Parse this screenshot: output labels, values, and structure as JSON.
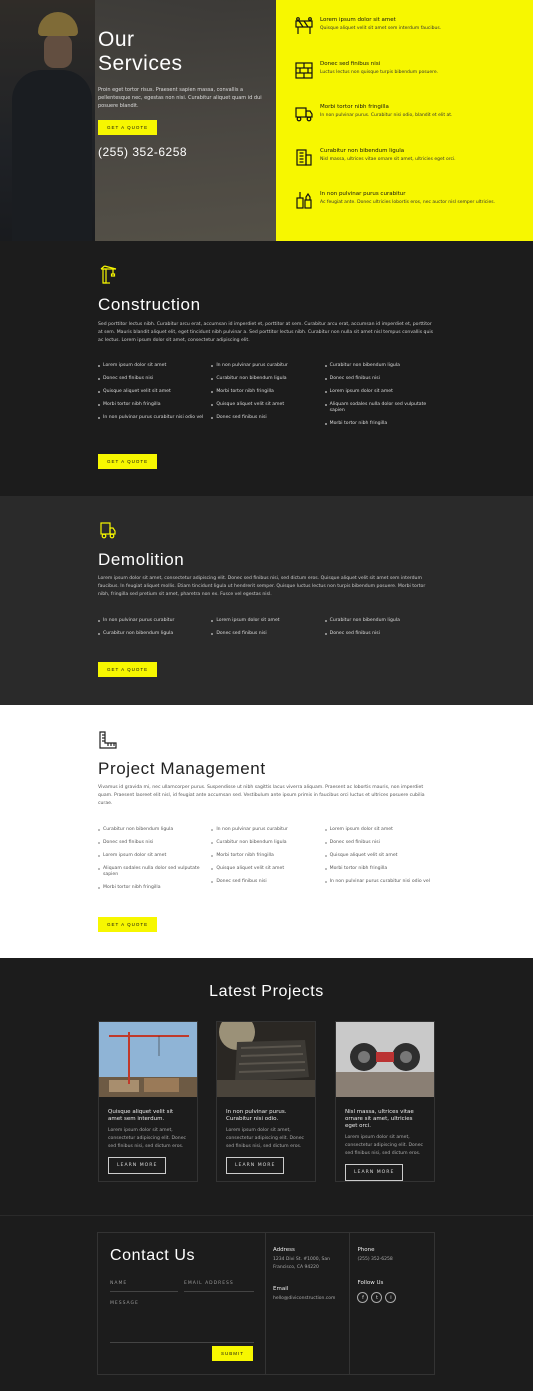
{
  "hero": {
    "title_line1": "Our",
    "title_line2": "Services",
    "description": "Proin eget tortor risus. Praesent sapien massa, convallis a pellentesque nec, egestas non nisi. Curabitur aliquet quam id dui posuere blandit.",
    "cta": "GET A QUOTE",
    "phone": "(255) 352-6258"
  },
  "services": [
    {
      "icon": "road-barrier-icon",
      "title": "Lorem ipsum dolor sit amet",
      "desc": "Quisque aliquet velit sit amet sem interdum faucibus."
    },
    {
      "icon": "brick-wall-icon",
      "title": "Donec sed finibus nisi",
      "desc": "Luctus lectus non quisque turpis bibendum posuere."
    },
    {
      "icon": "truck-icon",
      "title": "Morbi tortor nibh fringilla",
      "desc": "In non pulvinar purus. Curabitur nisi odio, blandit et elit at."
    },
    {
      "icon": "building-icon",
      "title": "Curabitur non bibendum ligula",
      "desc": "Nisl massa, ultrices vitae ornare sit amet, ultricies eget orci."
    },
    {
      "icon": "paint-tools-icon",
      "title": "In non pulvinar purus curabitur",
      "desc": "Ac feugiat ante. Donec ultricies lobortis eros, nec auctor nisl semper ultricies."
    }
  ],
  "construction": {
    "title": "Construction",
    "description": "Sed porttitor lectus nibh. Curabitur arcu erat, accumsan id imperdiet et, porttitor at sem. Curabitur arcu erat, accumsan id imperdiet et, porttitor at sem. Mauris blandit aliquet elit, eget tincidunt nibh pulvinar a. Sed porttitor lectus nibh. Curabitur non nulla sit amet nisl tempus convallis quis ac lectus. Lorem ipsum dolor sit amet, consectetur adipiscing elit.",
    "col1": [
      "Lorem ipsum dolor sit amet",
      "Donec sed finibus nisi",
      "Quisque aliquet velit sit amet",
      "Morbi tortor nibh fringilla",
      "In non pulvinar purus curabitur nisi odio vel"
    ],
    "col2": [
      "In non pulvinar purus curabitur",
      "Curabitur non bibendum ligula",
      "Morbi tortor nibh fringilla",
      "Quisque aliquet velit sit amet",
      "Donec sed finibus nisi"
    ],
    "col3": [
      "Curabitur non bibendum ligula",
      "Donec sed finibus nisi",
      "Lorem ipsum dolor sit amet",
      "Aliquam sodales nulla dolor sed vulputate sapien",
      "Morbi tortor nibh fringilla"
    ],
    "cta": "GET A QUOTE"
  },
  "demolition": {
    "title": "Demolition",
    "description": "Lorem ipsum dolor sit amet, consectetur adipiscing elit. Donec sed finibus nisi, sed dictum eros. Quisque aliquet velit sit amet sem interdum faucibus. In feugiat aliquet mollis. Etiam tincidunt ligula ut hendrerit semper. Quisque luctus lectus non turpis bibendum posuere. Morbi tortor nibh, fringilla sed pretium sit amet, pharetra non ex. Fusce vel egestas nisl.",
    "col1": [
      "In non pulvinar purus curabitur",
      "Curabitur non bibendum ligula"
    ],
    "col2": [
      "Lorem ipsum dolor sit amet",
      "Donec sed finibus nisi"
    ],
    "col3": [
      "Curabitur non bibendum ligula",
      "Donec sed finibus nisi"
    ],
    "cta": "GET A QUOTE"
  },
  "project_management": {
    "title": "Project Management",
    "description": "Vivamus id gravida mi, nec ullamcorper purus. Suspendisse ut nibh sagittis lacus viverra aliquam. Praesent ac lobortis mauris, non imperdiet quam. Praesent laoreet elit nisl, id feugiat ante accumsan sed. Vestibulum ante ipsum primis in faucibus orci luctus et ultrices posuere cubilia curae.",
    "col1": [
      "Curabitur non bibendum ligula",
      "Donec sed finibus nisi",
      "Lorem ipsum dolor sit amet",
      "Aliquam sodales nulla dolor sed vulputate sapien",
      "Morbi tortor nibh fringilla"
    ],
    "col2": [
      "In non pulvinar purus curabitur",
      "Curabitur non bibendum ligula",
      "Morbi tortor nibh fringilla",
      "Quisque aliquet velit sit amet",
      "Donec sed finibus nisi"
    ],
    "col3": [
      "Lorem ipsum dolor sit amet",
      "Donec sed finibus nisi",
      "Quisque aliquet velit sit amet",
      "Morbi tortor nibh fringilla",
      "In non pulvinar purus curabitur nisi odio vel"
    ],
    "cta": "GET A QUOTE"
  },
  "projects": {
    "title": "Latest Projects",
    "cards": [
      {
        "title": "Quisque aliquet velit sit amet sem interdum.",
        "desc": "Lorem ipsum dolor sit amet, consectetur adipiscing elit. Donec sed finibus nisi, sed dictum eros.",
        "button": "LEARN MORE"
      },
      {
        "title": "In non pulvinar purus. Curabitur nisi odio.",
        "desc": "Lorem ipsum dolor sit amet, consectetur adipiscing elit. Donec sed finibus nisi, sed dictum eros.",
        "button": "LEARN MORE"
      },
      {
        "title": "Nisl massa, ultrices vitae ornare sit amet, ultricies eget orci.",
        "desc": "Lorem ipsum dolor sit amet, consectetur adipiscing elit. Donec sed finibus nisi, sed dictum eros.",
        "button": "LEARN MORE"
      }
    ]
  },
  "contact": {
    "title": "Contact Us",
    "name_placeholder": "NAME",
    "email_placeholder": "EMAIL ADDRESS",
    "message_placeholder": "MESSAGE",
    "submit": "SUBMIT",
    "address_label": "Address",
    "address": "1234 Divi St. #1000, San Francisco, CA 94220",
    "email_label": "Email",
    "email": "hello@diviconstruction.com",
    "phone_label": "Phone",
    "phone": "(255) 352-6258",
    "follow_label": "Follow Us",
    "social": [
      "f",
      "t",
      "i"
    ]
  },
  "colors": {
    "accent": "#f7f700",
    "dark": "#1c1c1c",
    "mid": "#2a2a2a"
  }
}
